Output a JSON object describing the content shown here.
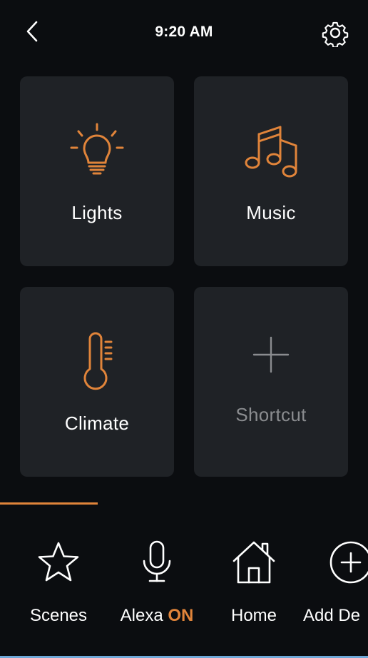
{
  "header": {
    "time": "9:20 AM",
    "back_icon": "chevron-left-icon",
    "settings_icon": "gear-icon"
  },
  "tiles": [
    {
      "label": "Lights",
      "icon": "lightbulb-icon"
    },
    {
      "label": "Music",
      "icon": "music-notes-icon"
    },
    {
      "label": "Climate",
      "icon": "thermometer-icon"
    },
    {
      "label": "Shortcut",
      "icon": "plus-icon"
    }
  ],
  "bottom_nav": {
    "items": [
      {
        "label": "Scenes",
        "icon": "star-icon"
      },
      {
        "label": "Alexa",
        "state": "ON",
        "icon": "microphone-icon"
      },
      {
        "label": "Home",
        "icon": "house-icon"
      },
      {
        "label": "Add De",
        "icon": "add-circle-icon"
      }
    ]
  },
  "colors": {
    "background": "#0b0d10",
    "tile": "#1f2226",
    "accent": "#e0843a",
    "muted": "#8a8c8f",
    "text": "#ffffff"
  }
}
